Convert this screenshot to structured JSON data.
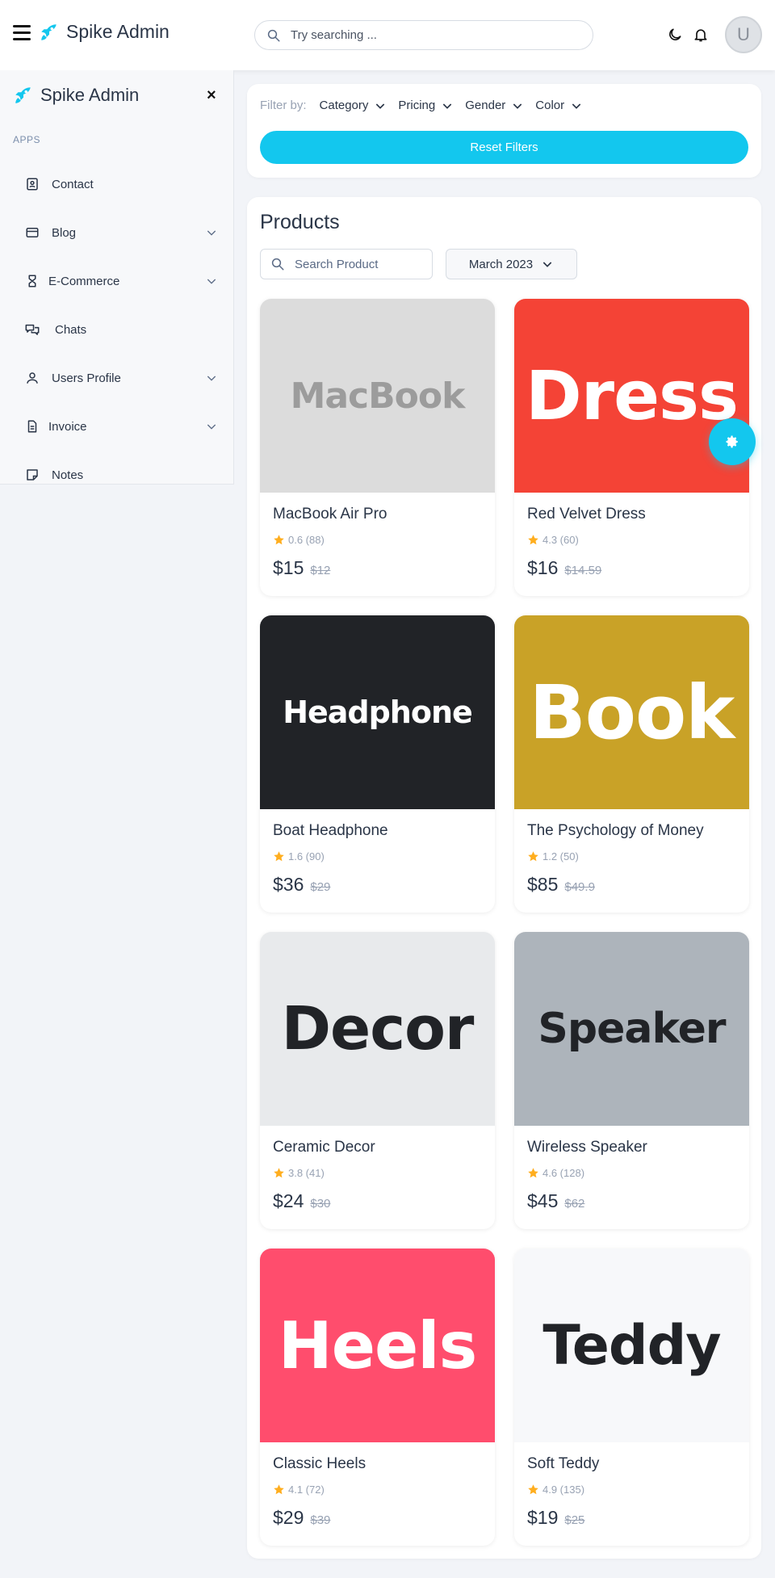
{
  "header": {
    "brand": "Spike Admin",
    "search_placeholder": "Try searching ...",
    "avatar_initial": "U"
  },
  "sidebar": {
    "brand": "Spike Admin",
    "close": "×",
    "section": "APPS",
    "items": [
      {
        "label": "Contact",
        "icon": "contact-icon",
        "expandable": false
      },
      {
        "label": "Blog",
        "icon": "blog-icon",
        "expandable": true
      },
      {
        "label": "E-Commerce",
        "icon": "ecommerce-icon",
        "expandable": true
      },
      {
        "label": "Chats",
        "icon": "chats-icon",
        "expandable": false
      },
      {
        "label": "Users Profile",
        "icon": "user-icon",
        "expandable": true
      },
      {
        "label": "Invoice",
        "icon": "invoice-icon",
        "expandable": true
      },
      {
        "label": "Notes",
        "icon": "notes-icon",
        "expandable": false
      }
    ]
  },
  "filters": {
    "label": "Filter by:",
    "dropdowns": [
      "Category",
      "Pricing",
      "Gender",
      "Color"
    ],
    "reset_label": "Reset Filters"
  },
  "products": {
    "title": "Products",
    "search_placeholder": "Search Product",
    "date_label": "March 2023",
    "items": [
      {
        "image_text": "MacBook",
        "bg": "#dcdcdc",
        "fg": "#9c9c9c",
        "name": "MacBook Air Pro",
        "rating": "0.6 (88)",
        "price": "$15",
        "old_price": "$12"
      },
      {
        "image_text": "Dress",
        "bg": "#f44336",
        "fg": "#ffffff",
        "name": "Red Velvet Dress",
        "rating": "4.3 (60)",
        "price": "$16",
        "old_price": "$14.59"
      },
      {
        "image_text": "Headphone",
        "bg": "#212327",
        "fg": "#ffffff",
        "name": "Boat Headphone",
        "rating": "1.6 (90)",
        "price": "$36",
        "old_price": "$29"
      },
      {
        "image_text": "Book",
        "bg": "#c9a227",
        "fg": "#ffffff",
        "name": "The Psychology of Money",
        "rating": "1.2 (50)",
        "price": "$85",
        "old_price": "$49.9"
      },
      {
        "image_text": "Decor",
        "bg": "#e8eaec",
        "fg": "#212327",
        "name": "Ceramic Decor",
        "rating": "3.8 (41)",
        "price": "$24",
        "old_price": "$30"
      },
      {
        "image_text": "Speaker",
        "bg": "#adb4bb",
        "fg": "#212327",
        "name": "Wireless Speaker",
        "rating": "4.6 (128)",
        "price": "$45",
        "old_price": "$62"
      },
      {
        "image_text": "Heels",
        "bg": "#ff4d6d",
        "fg": "#ffffff",
        "name": "Classic Heels",
        "rating": "4.1 (72)",
        "price": "$29",
        "old_price": "$39"
      },
      {
        "image_text": "Teddy",
        "bg": "#f7f8fa",
        "fg": "#212327",
        "name": "Soft Teddy",
        "rating": "4.9 (135)",
        "price": "$19",
        "old_price": "$25"
      }
    ]
  },
  "colors": {
    "accent": "#13c7ee",
    "star": "#ffae1f"
  }
}
